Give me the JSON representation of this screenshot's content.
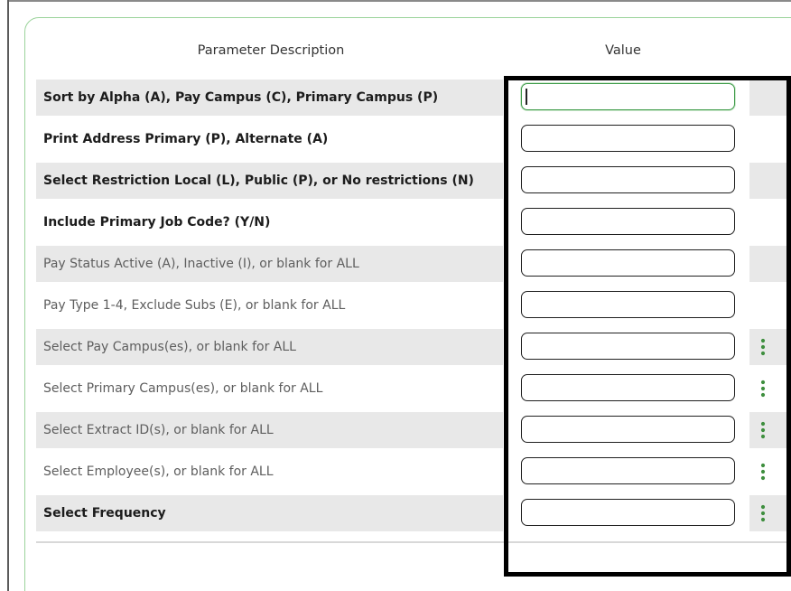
{
  "header": {
    "description_label": "Parameter Description",
    "value_label": "Value"
  },
  "rows": [
    {
      "label": "Sort by Alpha (A), Pay Campus (C), Primary Campus (P)",
      "value": "",
      "weight": "bold",
      "shaded": true,
      "focused": true,
      "has_lookup": false
    },
    {
      "label": "Print Address Primary (P), Alternate (A)",
      "value": "",
      "weight": "bold",
      "shaded": false,
      "focused": false,
      "has_lookup": false
    },
    {
      "label": "Select Restriction Local (L), Public (P), or No restrictions (N)",
      "value": "",
      "weight": "bold",
      "shaded": true,
      "focused": false,
      "has_lookup": false
    },
    {
      "label": "Include Primary Job Code? (Y/N)",
      "value": "",
      "weight": "bold",
      "shaded": false,
      "focused": false,
      "has_lookup": false
    },
    {
      "label": "Pay Status Active (A), Inactive (I), or blank for ALL",
      "value": "",
      "weight": "light",
      "shaded": true,
      "focused": false,
      "has_lookup": false
    },
    {
      "label": "Pay Type 1-4, Exclude Subs (E), or blank for ALL",
      "value": "",
      "weight": "light",
      "shaded": false,
      "focused": false,
      "has_lookup": false
    },
    {
      "label": "Select Pay Campus(es), or blank for ALL",
      "value": "",
      "weight": "light",
      "shaded": true,
      "focused": false,
      "has_lookup": true
    },
    {
      "label": "Select Primary Campus(es), or blank for ALL",
      "value": "",
      "weight": "light",
      "shaded": false,
      "focused": false,
      "has_lookup": true
    },
    {
      "label": "Select Extract ID(s), or blank for ALL",
      "value": "",
      "weight": "light",
      "shaded": true,
      "focused": false,
      "has_lookup": true
    },
    {
      "label": "Select Employee(s), or blank for ALL",
      "value": "",
      "weight": "light",
      "shaded": false,
      "focused": false,
      "has_lookup": true
    },
    {
      "label": "Select Frequency",
      "value": "",
      "weight": "bold",
      "shaded": true,
      "focused": false,
      "has_lookup": true
    }
  ],
  "colors": {
    "panel_border": "#9bd39b",
    "lookup_icon": "#3f8f3f",
    "row_shade": "#e8e8e8",
    "highlight_border": "#000000"
  },
  "icons": {
    "lookup": "kebab-vertical-icon"
  }
}
